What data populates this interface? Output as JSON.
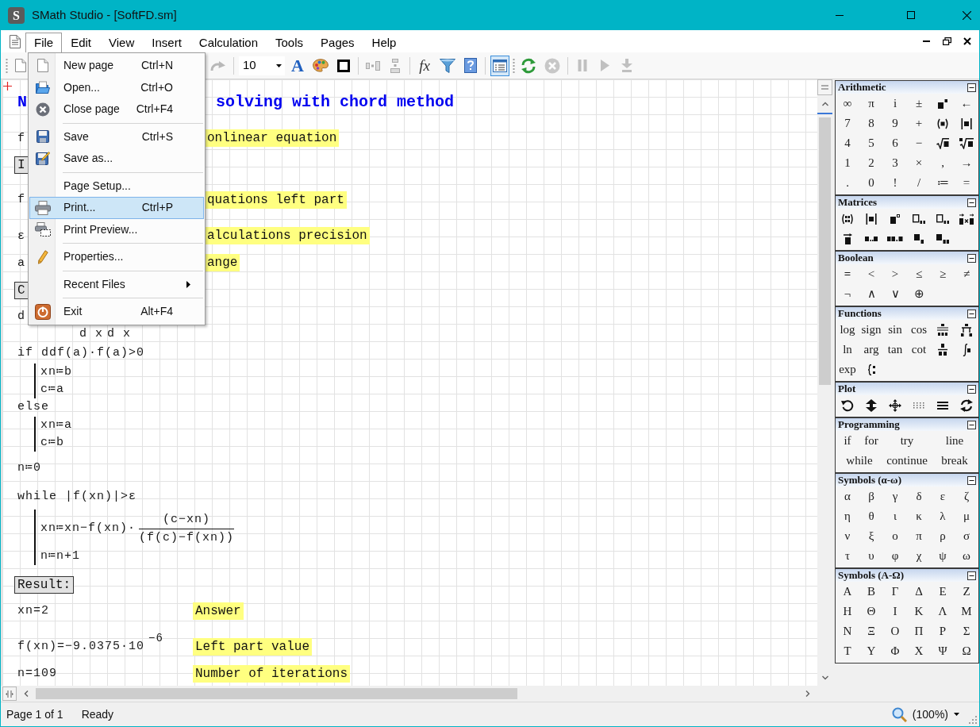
{
  "window": {
    "logo": "S",
    "title": "SMath Studio - [SoftFD.sm]"
  },
  "menu_bar": {
    "items": [
      {
        "label": "File",
        "selected": true
      },
      {
        "label": "Edit",
        "selected": false
      },
      {
        "label": "View",
        "selected": false
      },
      {
        "label": "Insert",
        "selected": false
      },
      {
        "label": "Calculation",
        "selected": false
      },
      {
        "label": "Tools",
        "selected": false
      },
      {
        "label": "Pages",
        "selected": false
      },
      {
        "label": "Help",
        "selected": false
      }
    ]
  },
  "file_menu": {
    "items": [
      {
        "kind": "item",
        "label": "New page",
        "shortcut": "Ctrl+N",
        "selected": false
      },
      {
        "kind": "item",
        "label": "Open...",
        "shortcut": "Ctrl+O",
        "selected": false
      },
      {
        "kind": "item",
        "label": "Close page",
        "shortcut": "Ctrl+F4",
        "selected": false
      },
      {
        "kind": "separator"
      },
      {
        "kind": "item",
        "label": "Save",
        "shortcut": "Ctrl+S",
        "selected": false
      },
      {
        "kind": "item",
        "label": "Save as...",
        "selected": false
      },
      {
        "kind": "separator"
      },
      {
        "kind": "item",
        "label": "Page Setup...",
        "selected": false
      },
      {
        "kind": "item",
        "label": "Print...",
        "shortcut": "Ctrl+P",
        "selected": true
      },
      {
        "kind": "item",
        "label": "Print Preview...",
        "selected": false
      },
      {
        "kind": "separator"
      },
      {
        "kind": "item",
        "label": "Properties...",
        "selected": false
      },
      {
        "kind": "separator"
      },
      {
        "kind": "submenu",
        "label": "Recent Files",
        "selected": false
      },
      {
        "kind": "separator"
      },
      {
        "kind": "item",
        "label": "Exit",
        "shortcut": "Alt+F4",
        "selected": false
      }
    ]
  },
  "toolbar": {
    "buttons": [
      {
        "kind": "icon",
        "disabled": false,
        "pressed": false
      },
      {
        "kind": "icon",
        "disabled": true,
        "pressed": false
      },
      {
        "kind": "glyph",
        "label": "A",
        "disabled": false,
        "pressed": false
      },
      {
        "kind": "icon",
        "disabled": false,
        "pressed": false
      },
      {
        "kind": "icon",
        "disabled": false,
        "pressed": false
      },
      {
        "kind": "icon",
        "disabled": true,
        "pressed": false
      },
      {
        "kind": "icon",
        "disabled": true,
        "pressed": false
      },
      {
        "kind": "glyph",
        "label": "fx",
        "disabled": false,
        "pressed": false
      },
      {
        "kind": "icon",
        "disabled": false,
        "pressed": false
      },
      {
        "kind": "icon",
        "disabled": false,
        "pressed": false
      },
      {
        "kind": "icon",
        "disabled": false,
        "pressed": true
      },
      {
        "kind": "icon",
        "disabled": false,
        "pressed": false
      },
      {
        "kind": "icon",
        "disabled": true,
        "pressed": false
      },
      {
        "kind": "icon",
        "disabled": true,
        "pressed": false
      },
      {
        "kind": "icon",
        "disabled": true,
        "pressed": false
      },
      {
        "kind": "icon",
        "disabled": true,
        "pressed": false
      }
    ],
    "font_size": "10"
  },
  "worksheet": {
    "regions": [
      {
        "kind": "heading",
        "text": "N"
      },
      {
        "kind": "heading",
        "text": "solving with chord method"
      },
      {
        "kind": "math",
        "text": "f"
      },
      {
        "kind": "comment",
        "text": "onlinear equation"
      },
      {
        "kind": "label",
        "text": "I"
      },
      {
        "kind": "math",
        "text": "f"
      },
      {
        "kind": "comment",
        "text": "quations left part"
      },
      {
        "kind": "math",
        "text": "ε"
      },
      {
        "kind": "comment",
        "text": "alculations precision"
      },
      {
        "kind": "math",
        "text": "a"
      },
      {
        "kind": "comment",
        "text": "ange"
      },
      {
        "kind": "label",
        "text": "C"
      },
      {
        "kind": "math",
        "text": "d"
      },
      {
        "kind": "math",
        "text": "d x"
      },
      {
        "kind": "math",
        "text": "d x"
      },
      {
        "kind": "math",
        "text": "if ddf(a)·f(a)>0"
      },
      {
        "kind": "block",
        "lines": [
          {
            "kind": "text",
            "text": "xn≔b"
          },
          {
            "kind": "text",
            "text": "c≔a"
          }
        ]
      },
      {
        "kind": "math",
        "text": "else"
      },
      {
        "kind": "block",
        "lines": [
          {
            "kind": "text",
            "text": "xn≔a"
          },
          {
            "kind": "text",
            "text": "c≔b"
          }
        ]
      },
      {
        "kind": "math",
        "text": "n≔0"
      },
      {
        "kind": "math",
        "text": "while |f(xn)|>ε"
      },
      {
        "kind": "block",
        "lines": [
          {
            "kind": "fraction",
            "lead": "xn≔xn−f(xn)·",
            "numerator": "(c−xn)",
            "denominator": "(f(c)−f(xn))"
          },
          {
            "kind": "text",
            "text": "n≔n+1"
          }
        ]
      },
      {
        "kind": "label",
        "text": "Result:"
      },
      {
        "kind": "math",
        "text": "xn=2"
      },
      {
        "kind": "comment",
        "text": "Answer"
      },
      {
        "kind": "math",
        "text": "f(xn)=−9.0375·10$^{−6}$"
      },
      {
        "kind": "comment",
        "text": "Left part value"
      },
      {
        "kind": "math",
        "text": "n=109"
      },
      {
        "kind": "comment",
        "text": "Number of iterations"
      }
    ]
  },
  "panels": [
    {
      "title": "Arithmetic",
      "expanded": true,
      "buttons": [
        {
          "kind": "text",
          "label": "∞"
        },
        {
          "kind": "text",
          "label": "π"
        },
        {
          "kind": "text",
          "label": "i"
        },
        {
          "kind": "text",
          "label": "±"
        },
        {
          "kind": "icon"
        },
        {
          "kind": "text",
          "label": "←"
        },
        {
          "kind": "text",
          "label": "7"
        },
        {
          "kind": "text",
          "label": "8"
        },
        {
          "kind": "text",
          "label": "9"
        },
        {
          "kind": "text",
          "label": "+"
        },
        {
          "kind": "icon"
        },
        {
          "kind": "icon"
        },
        {
          "kind": "text",
          "label": "4"
        },
        {
          "kind": "text",
          "label": "5"
        },
        {
          "kind": "text",
          "label": "6"
        },
        {
          "kind": "text",
          "label": "−"
        },
        {
          "kind": "icon"
        },
        {
          "kind": "icon"
        },
        {
          "kind": "text",
          "label": "1"
        },
        {
          "kind": "text",
          "label": "2"
        },
        {
          "kind": "text",
          "label": "3"
        },
        {
          "kind": "text",
          "label": "×"
        },
        {
          "kind": "text",
          "label": ","
        },
        {
          "kind": "text",
          "label": "→"
        },
        {
          "kind": "text",
          "label": "."
        },
        {
          "kind": "text",
          "label": "0"
        },
        {
          "kind": "text",
          "label": "!"
        },
        {
          "kind": "text",
          "label": "/"
        },
        {
          "kind": "text",
          "label": "≔"
        },
        {
          "kind": "text",
          "label": "="
        }
      ]
    },
    {
      "title": "Matrices",
      "expanded": true,
      "buttons": [
        {
          "kind": "icon"
        },
        {
          "kind": "icon"
        },
        {
          "kind": "icon"
        },
        {
          "kind": "icon"
        },
        {
          "kind": "icon"
        },
        {
          "kind": "icon"
        },
        {
          "kind": "icon"
        },
        {
          "kind": "icon"
        },
        {
          "kind": "icon"
        },
        {
          "kind": "icon"
        },
        {
          "kind": "icon"
        }
      ]
    },
    {
      "title": "Boolean",
      "expanded": true,
      "buttons": [
        {
          "kind": "text",
          "label": "="
        },
        {
          "kind": "text",
          "label": "<"
        },
        {
          "kind": "text",
          "label": ">"
        },
        {
          "kind": "text",
          "label": "≤"
        },
        {
          "kind": "text",
          "label": "≥"
        },
        {
          "kind": "text",
          "label": "≠"
        },
        {
          "kind": "text",
          "label": "¬"
        },
        {
          "kind": "text",
          "label": "∧"
        },
        {
          "kind": "text",
          "label": "∨"
        },
        {
          "kind": "text",
          "label": "⊕"
        }
      ]
    },
    {
      "title": "Functions",
      "expanded": true,
      "buttons": [
        {
          "kind": "text",
          "label": "log"
        },
        {
          "kind": "text",
          "label": "sign"
        },
        {
          "kind": "text",
          "label": "sin"
        },
        {
          "kind": "text",
          "label": "cos"
        },
        {
          "kind": "icon"
        },
        {
          "kind": "icon"
        },
        {
          "kind": "text",
          "label": "ln"
        },
        {
          "kind": "text",
          "label": "arg"
        },
        {
          "kind": "text",
          "label": "tan"
        },
        {
          "kind": "text",
          "label": "cot"
        },
        {
          "kind": "icon"
        },
        {
          "kind": "icon"
        },
        {
          "kind": "text",
          "label": "exp"
        },
        {
          "kind": "icon"
        }
      ]
    },
    {
      "title": "Plot",
      "expanded": true,
      "buttons": [
        {
          "kind": "icon"
        },
        {
          "kind": "icon"
        },
        {
          "kind": "icon"
        },
        {
          "kind": "icon"
        },
        {
          "kind": "icon"
        },
        {
          "kind": "icon"
        }
      ]
    },
    {
      "title": "Programming",
      "expanded": true,
      "buttons": [
        {
          "kind": "text",
          "label": "if"
        },
        {
          "kind": "text",
          "label": "for"
        },
        {
          "kind": "text",
          "label": "try"
        },
        {
          "kind": "text",
          "label": "line"
        },
        {
          "kind": "text",
          "label": "while"
        },
        {
          "kind": "text",
          "label": "continue"
        },
        {
          "kind": "text",
          "label": "break"
        }
      ]
    },
    {
      "title": "Symbols (α-ω)",
      "expanded": true,
      "buttons": [
        {
          "kind": "text",
          "label": "α"
        },
        {
          "kind": "text",
          "label": "β"
        },
        {
          "kind": "text",
          "label": "γ"
        },
        {
          "kind": "text",
          "label": "δ"
        },
        {
          "kind": "text",
          "label": "ε"
        },
        {
          "kind": "text",
          "label": "ζ"
        },
        {
          "kind": "text",
          "label": "η"
        },
        {
          "kind": "text",
          "label": "θ"
        },
        {
          "kind": "text",
          "label": "ι"
        },
        {
          "kind": "text",
          "label": "κ"
        },
        {
          "kind": "text",
          "label": "λ"
        },
        {
          "kind": "text",
          "label": "μ"
        },
        {
          "kind": "text",
          "label": "ν"
        },
        {
          "kind": "text",
          "label": "ξ"
        },
        {
          "kind": "text",
          "label": "ο"
        },
        {
          "kind": "text",
          "label": "π"
        },
        {
          "kind": "text",
          "label": "ρ"
        },
        {
          "kind": "text",
          "label": "σ"
        },
        {
          "kind": "text",
          "label": "τ"
        },
        {
          "kind": "text",
          "label": "υ"
        },
        {
          "kind": "text",
          "label": "φ"
        },
        {
          "kind": "text",
          "label": "χ"
        },
        {
          "kind": "text",
          "label": "ψ"
        },
        {
          "kind": "text",
          "label": "ω"
        }
      ]
    },
    {
      "title": "Symbols (Α-Ω)",
      "expanded": true,
      "buttons": [
        {
          "kind": "text",
          "label": "Α"
        },
        {
          "kind": "text",
          "label": "Β"
        },
        {
          "kind": "text",
          "label": "Γ"
        },
        {
          "kind": "text",
          "label": "Δ"
        },
        {
          "kind": "text",
          "label": "Ε"
        },
        {
          "kind": "text",
          "label": "Ζ"
        },
        {
          "kind": "text",
          "label": "Η"
        },
        {
          "kind": "text",
          "label": "Θ"
        },
        {
          "kind": "text",
          "label": "Ι"
        },
        {
          "kind": "text",
          "label": "Κ"
        },
        {
          "kind": "text",
          "label": "Λ"
        },
        {
          "kind": "text",
          "label": "Μ"
        },
        {
          "kind": "text",
          "label": "Ν"
        },
        {
          "kind": "text",
          "label": "Ξ"
        },
        {
          "kind": "text",
          "label": "Ο"
        },
        {
          "kind": "text",
          "label": "Π"
        },
        {
          "kind": "text",
          "label": "Ρ"
        },
        {
          "kind": "text",
          "label": "Σ"
        },
        {
          "kind": "text",
          "label": "Τ"
        },
        {
          "kind": "text",
          "label": "Υ"
        },
        {
          "kind": "text",
          "label": "Φ"
        },
        {
          "kind": "text",
          "label": "Χ"
        },
        {
          "kind": "text",
          "label": "Ψ"
        },
        {
          "kind": "text",
          "label": "Ω"
        }
      ]
    }
  ],
  "status_bar": {
    "page": "Page 1 of 1",
    "status": "Ready",
    "zoom": "(100%)"
  }
}
